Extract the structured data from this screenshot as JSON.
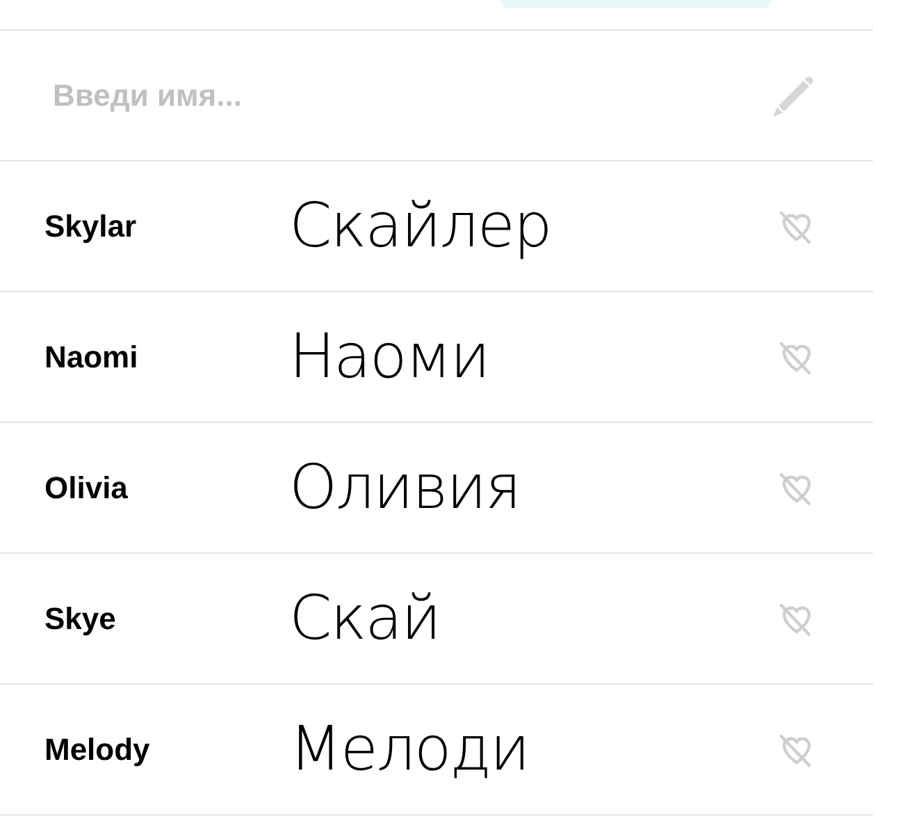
{
  "search": {
    "placeholder": "Введи имя..."
  },
  "names": [
    {
      "name": "Skylar",
      "translation": "Скайлер",
      "favorite": false
    },
    {
      "name": "Naomi",
      "translation": "Наоми",
      "favorite": false
    },
    {
      "name": "Olivia",
      "translation": "Оливия",
      "favorite": false
    },
    {
      "name": "Skye",
      "translation": "Скай",
      "favorite": false
    },
    {
      "name": "Melody",
      "translation": "Мелоди",
      "favorite": false
    }
  ]
}
